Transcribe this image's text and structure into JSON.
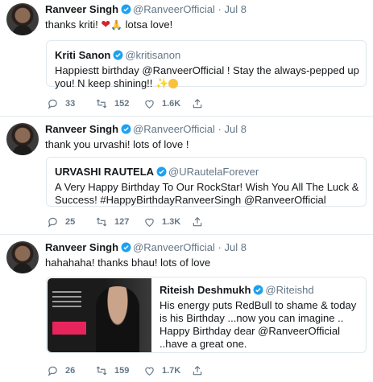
{
  "tweets": [
    {
      "name": "Ranveer Singh",
      "handle": "@RanveerOfficial",
      "dot": "·",
      "date": "Jul 8",
      "text": "thanks kriti! ",
      "text_suffix": " lotsa love!",
      "emoji": [
        "red-heart",
        "folded-hands"
      ],
      "quote": {
        "name": "Kriti Sanon",
        "handle": "@kritisanon",
        "text": "Happiestt birthday @RanveerOfficial ! Stay the always-pepped up you! N keep shining!!",
        "emoji": [
          "sparkles",
          "smiling-face"
        ]
      },
      "replies": "33",
      "retweets": "152",
      "likes": "1.6K"
    },
    {
      "name": "Ranveer Singh",
      "handle": "@RanveerOfficial",
      "dot": "·",
      "date": "Jul 8",
      "text": "thank you urvashi! lots of love !",
      "quote": {
        "name": "URVASHI RAUTELA",
        "handle": "@URautelaForever",
        "verified": true,
        "text": "A Very Happy Birthday To Our RockStar! Wish You All The Luck & Success! #HappyBirthdayRanveerSingh @RanveerOfficial"
      },
      "replies": "25",
      "retweets": "127",
      "likes": "1.3K"
    },
    {
      "name": "Ranveer Singh",
      "handle": "@RanveerOfficial",
      "dot": "·",
      "date": "Jul 8",
      "text": "hahahaha! thanks bhau! lots of love",
      "quote": {
        "name": "Riteish Deshmukh",
        "handle": "@Riteishd",
        "verified": true,
        "text": "His energy puts RedBull to shame & today is his Birthday ...now you can imagine .. Happy Birthday dear @RanveerOfficial ..have a great one.",
        "has_image": true
      },
      "replies": "26",
      "retweets": "159",
      "likes": "1.7K"
    }
  ],
  "colors": {
    "verified": "#1da1f2",
    "muted": "#657786",
    "border": "#e1e8ed"
  }
}
